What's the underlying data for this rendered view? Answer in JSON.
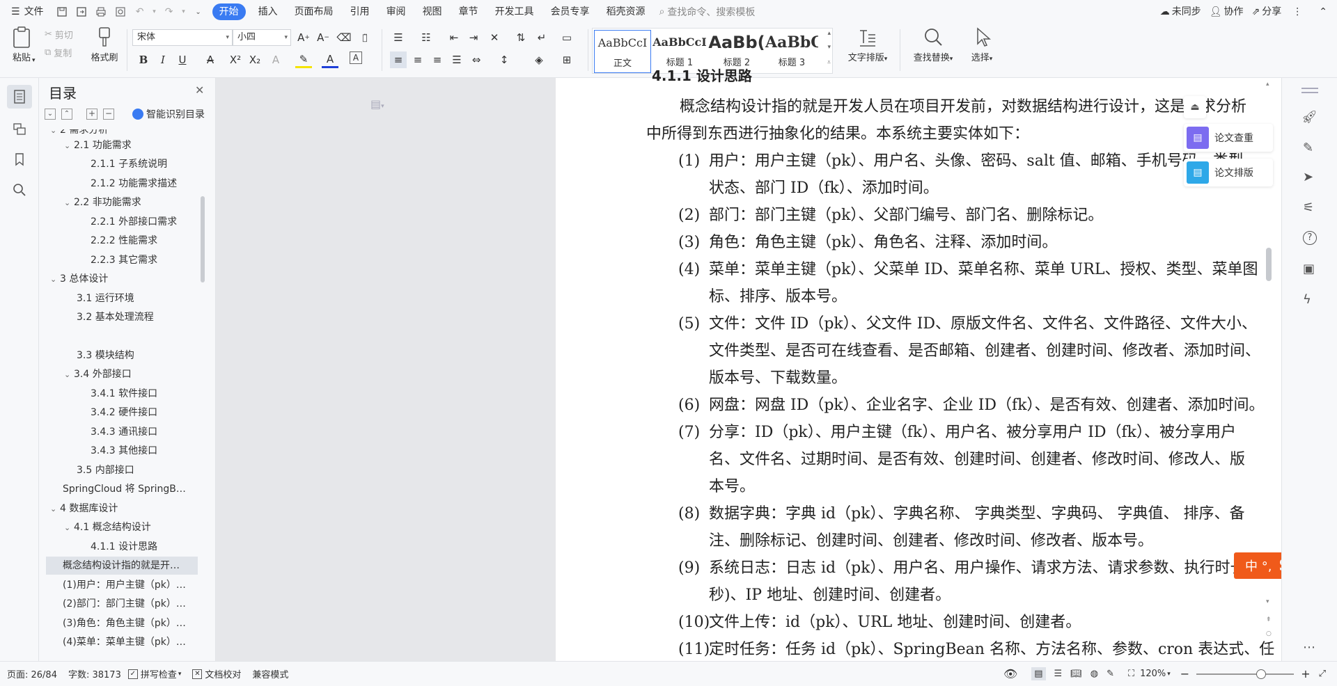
{
  "menubar": {
    "file": "文件",
    "tabs": [
      "开始",
      "插入",
      "页面布局",
      "引用",
      "审阅",
      "视图",
      "章节",
      "开发工具",
      "会员专享",
      "稻壳资源"
    ],
    "search_placeholder": "查找命令、搜索模板",
    "sync": "未同步",
    "collab": "协作",
    "share": "分享"
  },
  "ribbon": {
    "paste": "粘贴",
    "cut": "剪切",
    "copy": "复制",
    "format_painter": "格式刷",
    "font_name": "宋体",
    "font_size": "小四",
    "styles": [
      {
        "sample": "AaBbCcI",
        "label": "正文"
      },
      {
        "sample": "AaBbCcI",
        "label": "标题 1"
      },
      {
        "sample": "AaBb(",
        "label": "标题 2"
      },
      {
        "sample": "AaBbC",
        "label": "标题 3"
      }
    ],
    "text_layout": "文字排版",
    "find_replace": "查找替换",
    "select": "选择"
  },
  "toc": {
    "title": "目录",
    "smart": "智能识别目录",
    "items": [
      "2 需求分析",
      "2.1 功能需求",
      "2.1.1 子系统说明",
      "2.1.2 功能需求描述",
      "2.2 非功能需求",
      "2.2.1 外部接口需求",
      "2.2.2 性能需求",
      "2.2.3 其它需求",
      "3 总体设计",
      "3.1 运行环境",
      "3.2 基本处理流程",
      "3.3 模块结构",
      "3.4 外部接口",
      "3.4.1 软件接口",
      "3.4.2 硬件接口",
      "3.4.3 通讯接口",
      "3.4.3 其他接口",
      "3.5 内部接口",
      "SpringCloud 将 SpringB…",
      "4 数据库设计",
      "4.1 概念结构设计",
      "4.1.1 设计思路",
      "概念结构设计指的就是开…",
      "(1)用户：用户主键（pk）…",
      "(2)部门：部门主键（pk）…",
      "(3)角色：角色主键（pk）…",
      "(4)菜单：菜单主键（pk）…"
    ]
  },
  "document": {
    "heading": "4.1.1 设计思路",
    "intro_1": "概念结构设计指的就是开发人员在项目开发前，对数据结构进行设计，这是需求分析",
    "intro_2": "中所得到东西进行抽象化的结果。本系统主要实体如下：",
    "items": [
      {
        "n": "(1)",
        "l1": "用户：用户主键（pk）、用户名、头像、密码、salt 值、邮箱、手机号码、类型、",
        "l2": "状态、部门 ID（fk）、添加时间。"
      },
      {
        "n": "(2)",
        "l1": "部门：部门主键（pk）、父部门编号、部门名、删除标记。"
      },
      {
        "n": "(3)",
        "l1": "角色：角色主键（pk）、角色名、注释、添加时间。"
      },
      {
        "n": "(4)",
        "l1": "菜单：菜单主键（pk）、父菜单 ID、菜单名称、菜单 URL、授权、类型、菜单图",
        "l2": "标、排序、版本号。"
      },
      {
        "n": "(5)",
        "l1": "文件：文件 ID（pk）、父文件 ID、原版文件名、文件名、文件路径、文件大小、",
        "l2": "文件类型、是否可在线查看、是否邮箱、创建者、创建时间、修改者、添加时间、",
        "l3": "版本号、下载数量。"
      },
      {
        "n": "(6)",
        "l1": "网盘：网盘 ID（pk）、企业名字、企业 ID（fk）、是否有效、创建者、添加时间。"
      },
      {
        "n": "(7)",
        "l1": "分享：ID（pk）、用户主键（fk）、用户名、被分享用户 ID（fk）、被分享用户",
        "l2": "名、文件名、过期时间、是否有效、创建时间、创建者、修改时间、修改人、版",
        "l3": "本号。"
      },
      {
        "n": "(8)",
        "l1": "数据字典：字典 id（pk）、字典名称、 字典类型、字典码、 字典值、 排序、备",
        "l2": "注、删除标记、创建时间、创建者、修改时间、修改者、版本号。"
      },
      {
        "n": "(9)",
        "l1": "系统日志：日志 id（pk）、用户名、用户操作、请求方法、请求参数、执行时长(毫",
        "l2": "秒)、IP 地址、创建时间、创建者。"
      },
      {
        "n": "(10)",
        "l1": "文件上传：id（pk）、URL 地址、创建时间、创建者。"
      },
      {
        "n": "(11)",
        "l1": "定时任务：任务 id（pk）、SpringBean 名称、方法名称、参数、cron 表达式、任"
      }
    ]
  },
  "side_tools": {
    "check": "论文查重",
    "format": "论文排版"
  },
  "ime": "中 °,",
  "status": {
    "page": "页面: 26/84",
    "words": "字数: 38173",
    "spell": "拼写检查",
    "proof": "文档校对",
    "compat": "兼容模式",
    "zoom": "120%"
  },
  "colors": {
    "accent": "#3a7bf2",
    "ime": "#f05a1a"
  }
}
